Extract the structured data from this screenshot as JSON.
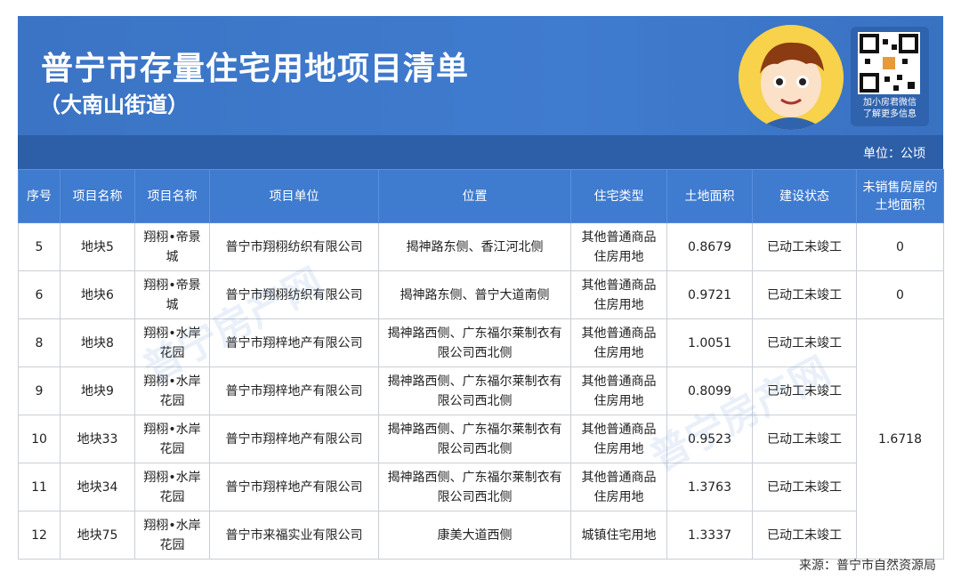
{
  "header": {
    "title": "普宁市存量住宅用地项目清单",
    "subtitle": "（大南山街道）",
    "qr_caption_1": "加小房君微信",
    "qr_caption_2": "了解更多信息"
  },
  "unit_label": "单位：公顷",
  "table": {
    "headers": [
      "序号",
      "项目名称",
      "项目名称",
      "项目单位",
      "位置",
      "住宅类型",
      "土地面积",
      "建设状态",
      "未销售房屋的土地面积"
    ],
    "rows": [
      {
        "no": "5",
        "plot": "地块5",
        "name": "翔栩•帝景城",
        "company": "普宁市翔栩纺织有限公司",
        "location": "揭神路东侧、香江河北侧",
        "type": "其他普通商品住房用地",
        "area": "0.8679",
        "status": "已动工未竣工",
        "unsold": "0"
      },
      {
        "no": "6",
        "plot": "地块6",
        "name": "翔栩•帝景城",
        "company": "普宁市翔栩纺织有限公司",
        "location": "揭神路东侧、普宁大道南侧",
        "type": "其他普通商品住房用地",
        "area": "0.9721",
        "status": "已动工未竣工",
        "unsold": "0"
      },
      {
        "no": "8",
        "plot": "地块8",
        "name": "翔栩•水岸花园",
        "company": "普宁市翔梓地产有限公司",
        "location": "揭神路西侧、广东福尔莱制衣有限公司西北侧",
        "type": "其他普通商品住房用地",
        "area": "1.0051",
        "status": "已动工未竣工"
      },
      {
        "no": "9",
        "plot": "地块9",
        "name": "翔栩•水岸花园",
        "company": "普宁市翔梓地产有限公司",
        "location": "揭神路西侧、广东福尔莱制衣有限公司西北侧",
        "type": "其他普通商品住房用地",
        "area": "0.8099",
        "status": "已动工未竣工"
      },
      {
        "no": "10",
        "plot": "地块33",
        "name": "翔栩•水岸花园",
        "company": "普宁市翔梓地产有限公司",
        "location": "揭神路西侧、广东福尔莱制衣有限公司西北侧",
        "type": "其他普通商品住房用地",
        "area": "0.9523",
        "status": "已动工未竣工"
      },
      {
        "no": "11",
        "plot": "地块34",
        "name": "翔栩•水岸花园",
        "company": "普宁市翔梓地产有限公司",
        "location": "揭神路西侧、广东福尔莱制衣有限公司西北侧",
        "type": "其他普通商品住房用地",
        "area": "1.3763",
        "status": "已动工未竣工"
      },
      {
        "no": "12",
        "plot": "地块75",
        "name": "翔栩•水岸花园",
        "company": "普宁市来福实业有限公司",
        "location": "康美大道西侧",
        "type": "城镇住宅用地",
        "area": "1.3337",
        "status": "已动工未竣工"
      }
    ],
    "merged_unsold": "1.6718"
  },
  "watermark": "普宁房产网",
  "source": "来源：普宁市自然资源局"
}
